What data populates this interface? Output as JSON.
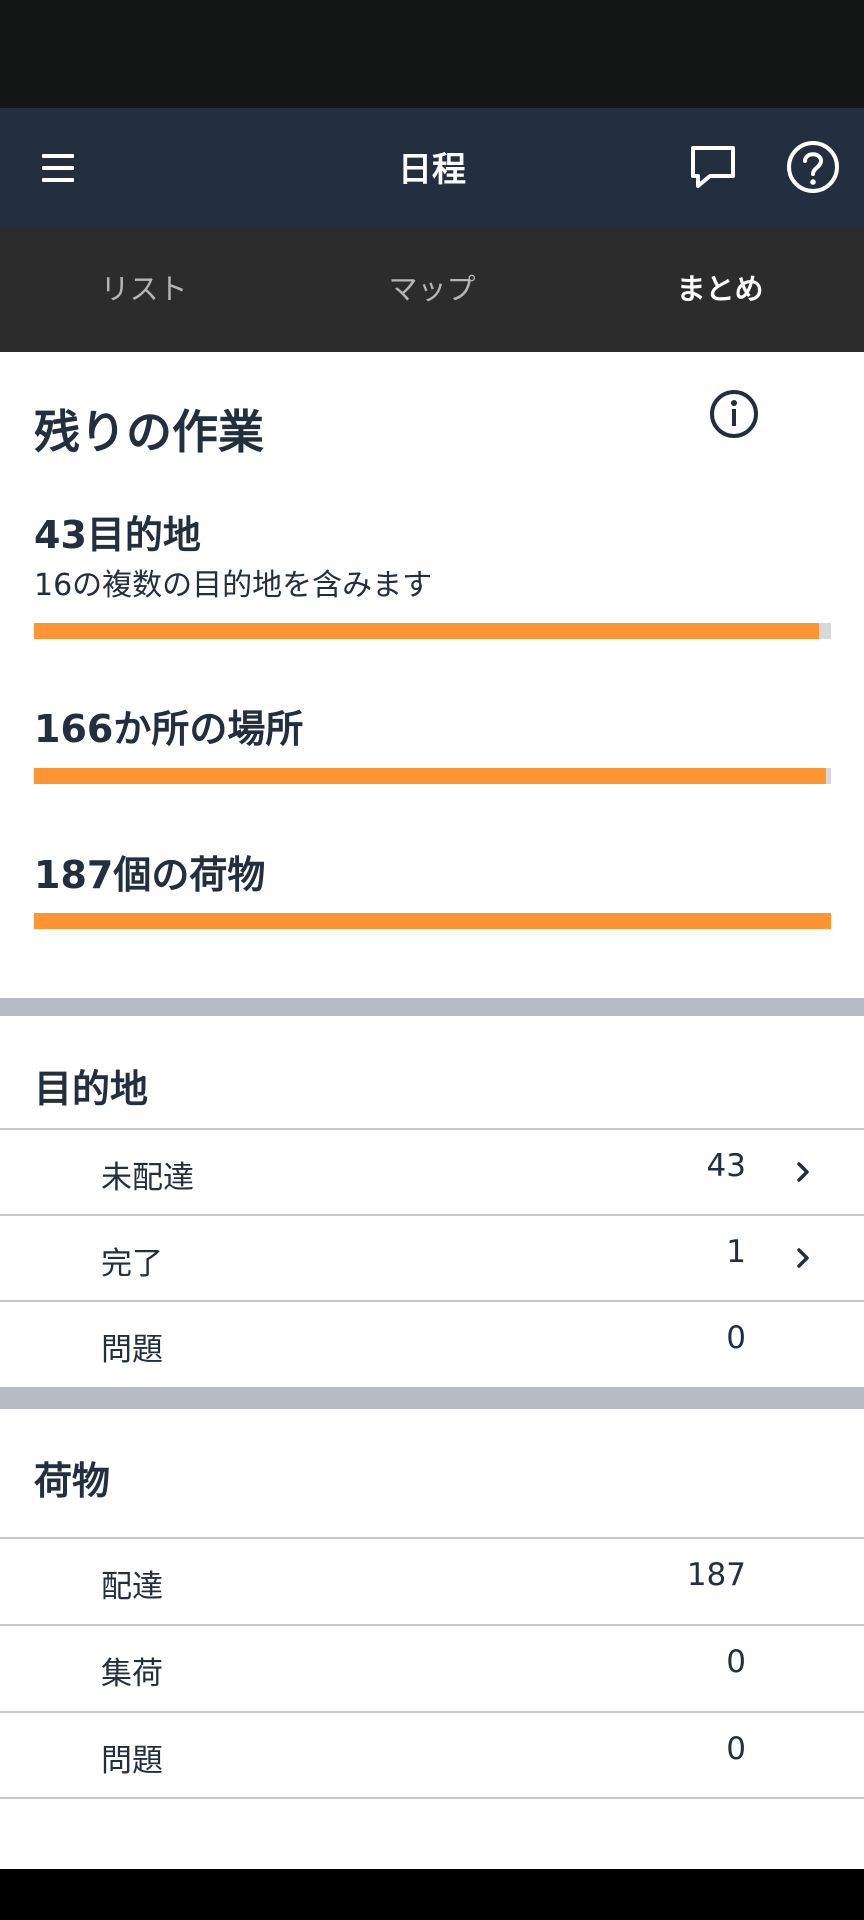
{
  "app_bar": {
    "title": "日程",
    "menu_icon": "menu-icon",
    "chat_icon": "chat-icon",
    "help_icon": "help-icon"
  },
  "tabs": [
    {
      "label": "リスト",
      "active": false
    },
    {
      "label": "マップ",
      "active": false
    },
    {
      "label": "まとめ",
      "active": true
    }
  ],
  "summary": {
    "heading": "残りの作業",
    "info_icon": "info-icon",
    "stats": [
      {
        "title": "43目的地",
        "subtitle": "16の複数の目的地を含みます",
        "progress": 0.985
      },
      {
        "title": "166か所の場所",
        "progress": 0.994
      },
      {
        "title": "187個の荷物",
        "progress": 1.0
      }
    ]
  },
  "destinations": {
    "heading": "目的地",
    "rows": [
      {
        "label": "未配達",
        "value": "43",
        "chevron": true
      },
      {
        "label": "完了",
        "value": "1",
        "chevron": true
      },
      {
        "label": "問題",
        "value": "0",
        "chevron": false
      }
    ]
  },
  "packages": {
    "heading": "荷物",
    "rows": [
      {
        "label": "配達",
        "value": "187"
      },
      {
        "label": "集荷",
        "value": "0"
      },
      {
        "label": "問題",
        "value": "0"
      }
    ]
  },
  "colors": {
    "header": "#232f3e",
    "tabs": "#2c2c2c",
    "accent": "#ff9432",
    "divider": "#b6bbc6"
  }
}
